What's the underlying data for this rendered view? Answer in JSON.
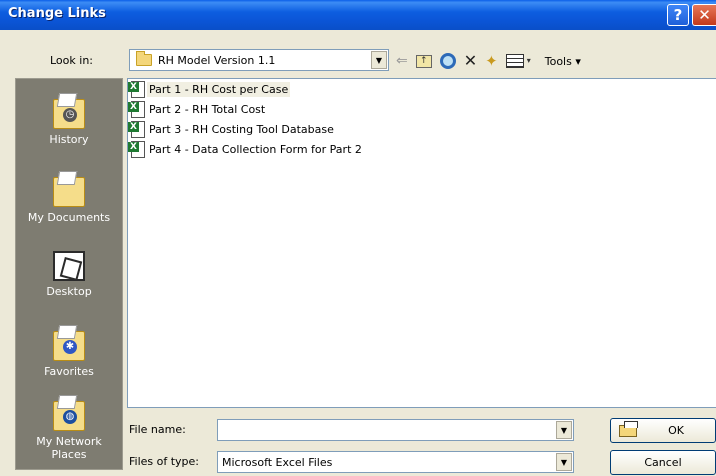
{
  "window": {
    "title": "Change Links",
    "help_glyph": "?",
    "close_glyph": "✕"
  },
  "lookin": {
    "label": "Look in:",
    "value": "RH Model Version 1.1",
    "folder_icon": "folder-icon"
  },
  "toolbar": {
    "back_glyph": "⇐",
    "delete_glyph": "✕",
    "newfolder_glyph": "✦",
    "views_dd": "▾",
    "tools_label": "Tools ▾"
  },
  "places": [
    {
      "label": "History",
      "icon": "history-icon",
      "glyph": "◷",
      "glyph_bg": "#555555"
    },
    {
      "label": "My Documents",
      "icon": "my-documents-icon",
      "glyph": "",
      "glyph_bg": ""
    },
    {
      "label": "Desktop",
      "icon": "desktop-icon",
      "glyph": "",
      "glyph_bg": ""
    },
    {
      "label": "Favorites",
      "icon": "favorites-icon",
      "glyph": "✱",
      "glyph_bg": "#2f57c4"
    },
    {
      "label": "My Network Places",
      "icon": "network-places-icon",
      "glyph": "◍",
      "glyph_bg": "#1d4fa0"
    }
  ],
  "files": [
    {
      "name": "Part 1 - RH Cost per Case",
      "selected": true
    },
    {
      "name": "Part 2 - RH Total Cost",
      "selected": false
    },
    {
      "name": "Part 3 - RH Costing Tool Database",
      "selected": false
    },
    {
      "name": "Part 4 - Data Collection Form for Part 2",
      "selected": false
    }
  ],
  "filename": {
    "label": "File name:",
    "value": ""
  },
  "filetype": {
    "label": "Files of type:",
    "value": "Microsoft Excel Files"
  },
  "buttons": {
    "ok": "OK",
    "cancel": "Cancel"
  },
  "dropdown_glyph": "▼",
  "colors": {
    "titlebar": "#0b55d6",
    "places_bg": "#7e7c71",
    "dialog_bg": "#ece9d8",
    "excel_green": "#1f7a32"
  }
}
